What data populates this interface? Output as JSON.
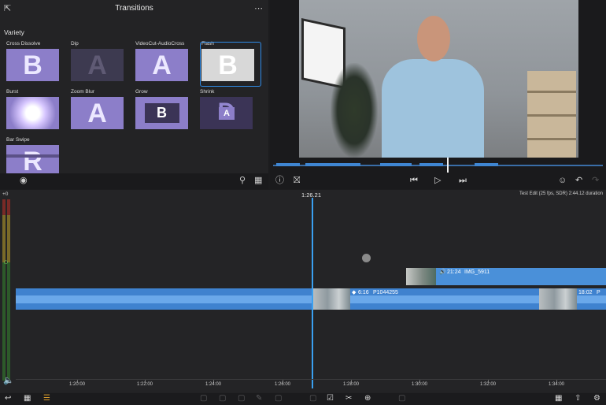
{
  "browser": {
    "title": "Transitions",
    "section": "Variety",
    "items": [
      {
        "label": "Cross Dissolve",
        "glyph": "B"
      },
      {
        "label": "Dip",
        "glyph": "A"
      },
      {
        "label": "VideoCut-AudioCross",
        "glyph": "A"
      },
      {
        "label": "Flash",
        "glyph": "B"
      },
      {
        "label": "Burst",
        "glyph": ""
      },
      {
        "label": "Zoom Blur",
        "glyph": "A"
      },
      {
        "label": "Grow",
        "glyph": "B"
      },
      {
        "label": "Shrink",
        "glyph": "D",
        "inner": "A"
      },
      {
        "label": "Bar Swipe",
        "glyph": "R"
      }
    ],
    "selected": "Flash",
    "icons": {
      "more": "more-circle-icon",
      "search": "search-icon",
      "filter": "filter-grid-icon",
      "toggle": "radio-icon"
    }
  },
  "timeline": {
    "timecode": "1:26.21",
    "project_info": "Test Edit (25 fps, SDR)   2:44.12 duration",
    "meter_label": "+0",
    "upper_clip": {
      "duration": "21:24",
      "name": "IMG_5911"
    },
    "main_clip_a": {
      "duration": "6:16",
      "name": "P1044255"
    },
    "main_clip_b": {
      "duration": "18:02",
      "name": "P"
    },
    "ruler": [
      "1:20:00",
      "1:22:00",
      "1:24:00",
      "1:26:00",
      "1:28:00",
      "1:30:00",
      "1:32:00",
      "1:34:00"
    ]
  },
  "viewer": {
    "icons": [
      "info-icon",
      "mark-icon",
      "skip-back-icon",
      "play-icon",
      "skip-forward-icon",
      "share-person-icon",
      "undo-icon"
    ]
  },
  "colors": {
    "accent": "#2f8ce8",
    "clip": "#4a90d9",
    "transition": "#8c7ec9"
  }
}
